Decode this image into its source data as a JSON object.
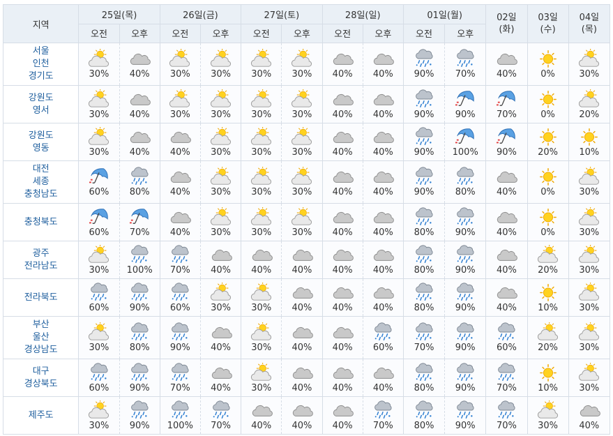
{
  "header": {
    "region_label": "지역",
    "days": [
      {
        "label": "25일(목)",
        "split": true
      },
      {
        "label": "26일(금)",
        "split": true
      },
      {
        "label": "27일(토)",
        "split": true
      },
      {
        "label": "28일(일)",
        "split": true
      },
      {
        "label": "01일(월)",
        "split": true
      },
      {
        "label": "02일\n(화)",
        "split": false
      },
      {
        "label": "03일\n(수)",
        "split": false
      },
      {
        "label": "04일\n(목)",
        "split": false
      }
    ],
    "am_label": "오전",
    "pm_label": "오후"
  },
  "rows": [
    {
      "region": "서울\n인천\n경기도",
      "h": 61,
      "cells": [
        [
          "partly-cloudy-icon",
          "30%"
        ],
        [
          "cloudy-icon",
          "40%"
        ],
        [
          "partly-cloudy-icon",
          "30%"
        ],
        [
          "partly-cloudy-icon",
          "30%"
        ],
        [
          "partly-cloudy-icon",
          "30%"
        ],
        [
          "partly-cloudy-icon",
          "30%"
        ],
        [
          "cloudy-icon",
          "40%"
        ],
        [
          "cloudy-icon",
          "40%"
        ],
        [
          "rain-snow-icon",
          "90%"
        ],
        [
          "rain-snow-icon",
          "70%"
        ],
        [
          "cloudy-icon",
          "40%"
        ],
        [
          "sunny-icon",
          "0%"
        ],
        [
          "partly-cloudy-icon",
          "30%"
        ]
      ]
    },
    {
      "region": "강원도\n영서",
      "h": 54,
      "cells": [
        [
          "partly-cloudy-icon",
          "30%"
        ],
        [
          "cloudy-icon",
          "40%"
        ],
        [
          "partly-cloudy-icon",
          "30%"
        ],
        [
          "partly-cloudy-icon",
          "30%"
        ],
        [
          "partly-cloudy-icon",
          "30%"
        ],
        [
          "partly-cloudy-icon",
          "30%"
        ],
        [
          "cloudy-icon",
          "40%"
        ],
        [
          "cloudy-icon",
          "40%"
        ],
        [
          "rain-snow-icon",
          "90%"
        ],
        [
          "umbrella-icon",
          "90%"
        ],
        [
          "umbrella-icon",
          "70%"
        ],
        [
          "sunny-icon",
          "0%"
        ],
        [
          "partly-cloudy-icon",
          "20%"
        ]
      ]
    },
    {
      "region": "강원도\n영동",
      "h": 54,
      "cells": [
        [
          "partly-cloudy-icon",
          "30%"
        ],
        [
          "cloudy-icon",
          "40%"
        ],
        [
          "cloudy-icon",
          "40%"
        ],
        [
          "partly-cloudy-icon",
          "30%"
        ],
        [
          "partly-cloudy-icon",
          "30%"
        ],
        [
          "partly-cloudy-icon",
          "30%"
        ],
        [
          "cloudy-icon",
          "40%"
        ],
        [
          "cloudy-icon",
          "40%"
        ],
        [
          "rain-snow-icon",
          "90%"
        ],
        [
          "umbrella-icon",
          "100%"
        ],
        [
          "umbrella-icon",
          "90%"
        ],
        [
          "sunny-icon",
          "20%"
        ],
        [
          "sunny-icon",
          "10%"
        ]
      ]
    },
    {
      "region": "대전\n세종\n충청남도",
      "h": 61,
      "cells": [
        [
          "umbrella-icon",
          "60%"
        ],
        [
          "rain-snow-icon",
          "80%"
        ],
        [
          "cloudy-icon",
          "40%"
        ],
        [
          "partly-cloudy-icon",
          "30%"
        ],
        [
          "partly-cloudy-icon",
          "30%"
        ],
        [
          "partly-cloudy-icon",
          "30%"
        ],
        [
          "cloudy-icon",
          "40%"
        ],
        [
          "cloudy-icon",
          "40%"
        ],
        [
          "rain-snow-icon",
          "90%"
        ],
        [
          "rain-snow-icon",
          "80%"
        ],
        [
          "cloudy-icon",
          "40%"
        ],
        [
          "sunny-icon",
          "0%"
        ],
        [
          "partly-cloudy-icon",
          "30%"
        ]
      ]
    },
    {
      "region": "충청북도",
      "h": 54,
      "cells": [
        [
          "umbrella-icon",
          "60%"
        ],
        [
          "umbrella-icon",
          "70%"
        ],
        [
          "cloudy-icon",
          "40%"
        ],
        [
          "partly-cloudy-icon",
          "30%"
        ],
        [
          "partly-cloudy-icon",
          "30%"
        ],
        [
          "partly-cloudy-icon",
          "30%"
        ],
        [
          "cloudy-icon",
          "40%"
        ],
        [
          "cloudy-icon",
          "40%"
        ],
        [
          "rain-snow-icon",
          "80%"
        ],
        [
          "rain-snow-icon",
          "90%"
        ],
        [
          "cloudy-icon",
          "40%"
        ],
        [
          "sunny-icon",
          "0%"
        ],
        [
          "partly-cloudy-icon",
          "30%"
        ]
      ]
    },
    {
      "region": "광주\n전라남도",
      "h": 54,
      "cells": [
        [
          "partly-cloudy-icon",
          "30%"
        ],
        [
          "rain-snow-icon",
          "100%"
        ],
        [
          "rain-snow-icon",
          "70%"
        ],
        [
          "cloudy-icon",
          "40%"
        ],
        [
          "cloudy-icon",
          "40%"
        ],
        [
          "cloudy-icon",
          "40%"
        ],
        [
          "cloudy-icon",
          "40%"
        ],
        [
          "cloudy-icon",
          "40%"
        ],
        [
          "rain-snow-icon",
          "80%"
        ],
        [
          "rain-snow-icon",
          "90%"
        ],
        [
          "cloudy-icon",
          "40%"
        ],
        [
          "partly-cloudy-icon",
          "20%"
        ],
        [
          "partly-cloudy-icon",
          "30%"
        ]
      ]
    },
    {
      "region": "전라북도",
      "h": 54,
      "cells": [
        [
          "rain-snow-icon",
          "60%"
        ],
        [
          "rain-snow-icon",
          "90%"
        ],
        [
          "rain-snow-icon",
          "60%"
        ],
        [
          "partly-cloudy-icon",
          "30%"
        ],
        [
          "partly-cloudy-icon",
          "30%"
        ],
        [
          "cloudy-icon",
          "40%"
        ],
        [
          "cloudy-icon",
          "40%"
        ],
        [
          "cloudy-icon",
          "40%"
        ],
        [
          "rain-snow-icon",
          "80%"
        ],
        [
          "rain-snow-icon",
          "90%"
        ],
        [
          "cloudy-icon",
          "40%"
        ],
        [
          "sunny-icon",
          "10%"
        ],
        [
          "partly-cloudy-icon",
          "30%"
        ]
      ]
    },
    {
      "region": "부산\n울산\n경상남도",
      "h": 61,
      "cells": [
        [
          "partly-cloudy-icon",
          "30%"
        ],
        [
          "rain-snow-icon",
          "80%"
        ],
        [
          "rain-snow-icon",
          "90%"
        ],
        [
          "cloudy-icon",
          "40%"
        ],
        [
          "partly-cloudy-icon",
          "30%"
        ],
        [
          "cloudy-icon",
          "40%"
        ],
        [
          "cloudy-icon",
          "40%"
        ],
        [
          "rain-snow-icon",
          "60%"
        ],
        [
          "rain-snow-icon",
          "70%"
        ],
        [
          "rain-snow-icon",
          "90%"
        ],
        [
          "rain-snow-icon",
          "60%"
        ],
        [
          "partly-cloudy-icon",
          "20%"
        ],
        [
          "partly-cloudy-icon",
          "30%"
        ]
      ]
    },
    {
      "region": "대구\n경상북도",
      "h": 54,
      "cells": [
        [
          "rain-snow-icon",
          "60%"
        ],
        [
          "rain-snow-icon",
          "90%"
        ],
        [
          "rain-snow-icon",
          "70%"
        ],
        [
          "cloudy-icon",
          "40%"
        ],
        [
          "partly-cloudy-icon",
          "30%"
        ],
        [
          "cloudy-icon",
          "40%"
        ],
        [
          "cloudy-icon",
          "40%"
        ],
        [
          "cloudy-icon",
          "40%"
        ],
        [
          "rain-snow-icon",
          "80%"
        ],
        [
          "rain-snow-icon",
          "90%"
        ],
        [
          "rain-snow-icon",
          "70%"
        ],
        [
          "sunny-icon",
          "10%"
        ],
        [
          "partly-cloudy-icon",
          "30%"
        ]
      ]
    },
    {
      "region": "제주도",
      "h": 54,
      "cells": [
        [
          "partly-cloudy-icon",
          "30%"
        ],
        [
          "rain-snow-icon",
          "90%"
        ],
        [
          "rain-snow-icon",
          "100%"
        ],
        [
          "rain-snow-icon",
          "70%"
        ],
        [
          "cloudy-icon",
          "40%"
        ],
        [
          "cloudy-icon",
          "40%"
        ],
        [
          "cloudy-icon",
          "40%"
        ],
        [
          "rain-snow-icon",
          "70%"
        ],
        [
          "rain-snow-icon",
          "80%"
        ],
        [
          "rain-snow-icon",
          "90%"
        ],
        [
          "rain-snow-icon",
          "70%"
        ],
        [
          "partly-cloudy-icon",
          "30%"
        ],
        [
          "cloudy-icon",
          "40%"
        ]
      ]
    }
  ]
}
